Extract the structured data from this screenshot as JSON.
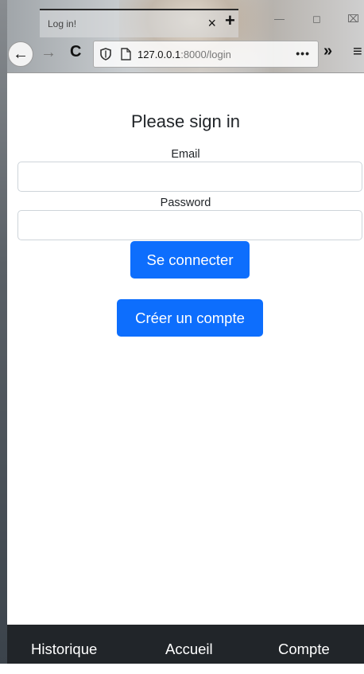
{
  "browser": {
    "tab_title": "Log in!",
    "tab_close": "×",
    "new_tab": "+",
    "url_host": "127.0.0.1",
    "url_path": ":8000/login",
    "url_more": "•••",
    "overflow": "»",
    "menu": "≡"
  },
  "page": {
    "title": "Please sign in",
    "email_label": "Email",
    "email_value": "",
    "password_label": "Password",
    "password_value": "",
    "login_button": "Se connecter",
    "register_button": "Créer un compte"
  },
  "nav": {
    "items": [
      {
        "label": "Historique"
      },
      {
        "label": "Accueil"
      },
      {
        "label": "Compte"
      }
    ]
  },
  "colors": {
    "primary": "#0d6efd",
    "navbar": "#212529"
  }
}
